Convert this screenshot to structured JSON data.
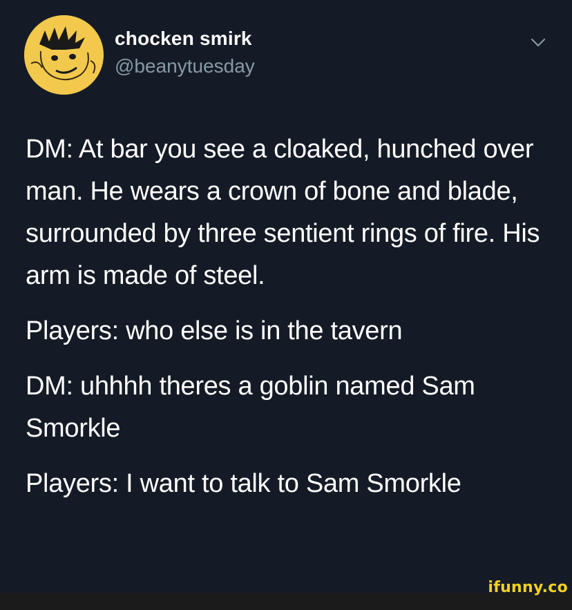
{
  "tweet": {
    "display_name": "chocken smirk",
    "handle": "@beanytuesday",
    "avatar_icon": "cartoon-avatar-icon",
    "menu_icon": "chevron-down-icon",
    "paragraphs": [
      "DM: At bar you see a cloaked, hunched over man. He wears a crown of bone and blade, surrounded by three sentient rings of fire. His arm is made of steel.",
      "Players: who else is in the tavern",
      "DM: uhhhh theres a goblin named Sam Smorkle",
      "Players: I want to talk to Sam Smorkle"
    ]
  },
  "watermark": {
    "text": "ifunny.co",
    "color": "#f2d21a"
  },
  "colors": {
    "background": "#151b26",
    "text": "#ffffff",
    "secondary_text": "#8899a6",
    "avatar_bg": "#f2c94c"
  }
}
